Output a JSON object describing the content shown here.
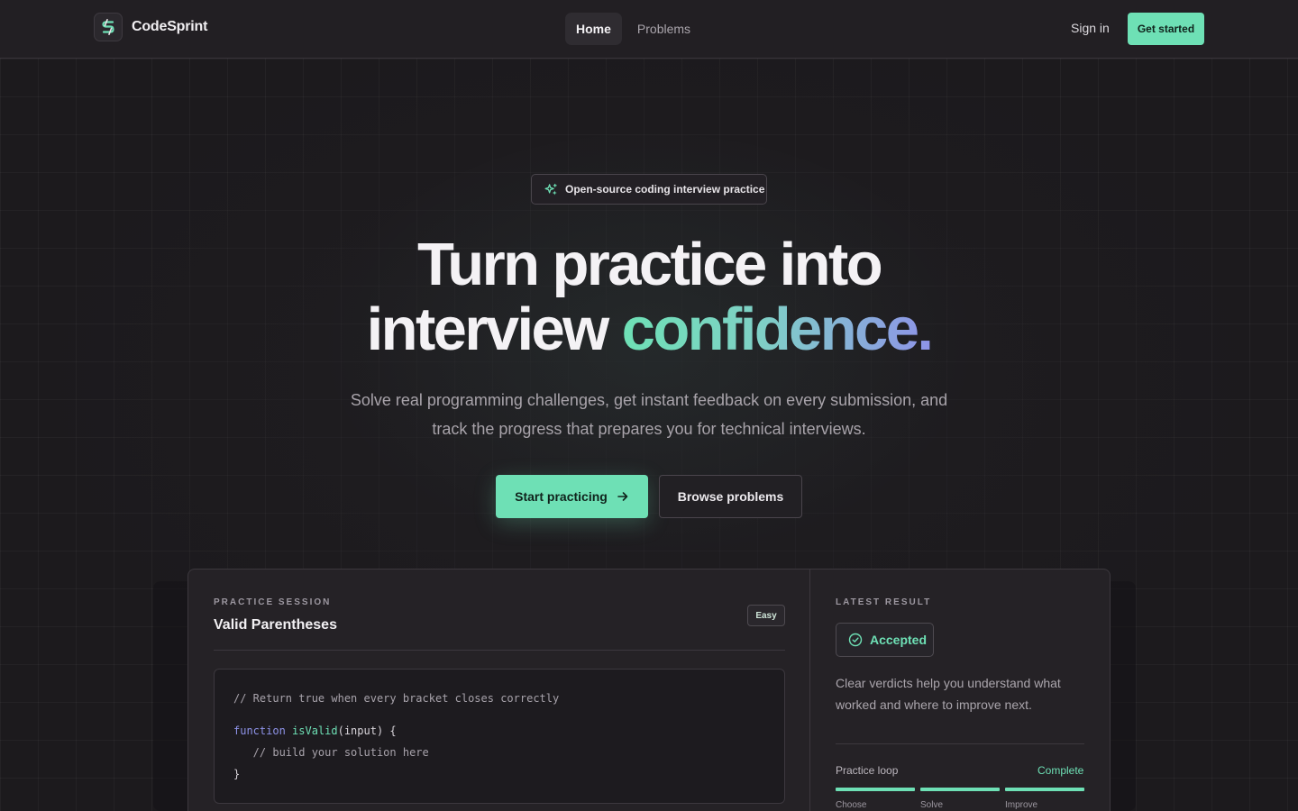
{
  "nav": {
    "brand": "CodeSprint",
    "links": [
      {
        "label": "Home",
        "active": true
      },
      {
        "label": "Problems",
        "active": false
      }
    ],
    "sign_in": "Sign in",
    "get_started": "Get started"
  },
  "hero": {
    "badge": "Open-source coding interview practice",
    "headline_line1": "Turn practice into",
    "headline_line2_plain": "interview ",
    "headline_line2_accent": "confidence.",
    "subtext": "Solve real programming challenges, get instant feedback on every submission, and track the progress that prepares you for technical interviews.",
    "primary_cta": "Start practicing",
    "secondary_cta": "Browse problems"
  },
  "session": {
    "eyebrow": "PRACTICE SESSION",
    "title": "Valid Parentheses",
    "difficulty": "Easy",
    "code": {
      "comment": "// Return true when every bracket closes correctly",
      "keyword": "function",
      "fn_name": "isValid",
      "signature_rest": "(input) {",
      "body_comment": "   // build your solution here",
      "closing": "}"
    }
  },
  "result": {
    "eyebrow": "LATEST RESULT",
    "verdict": "Accepted",
    "description": "Clear verdicts help you understand what worked and where to improve next.",
    "loop_label": "Practice loop",
    "loop_status": "Complete",
    "steps": [
      "Choose",
      "Solve",
      "Improve"
    ]
  },
  "colors": {
    "accent": "#6ee0b5",
    "accent_secondary": "#8e93e8",
    "background": "#1c1a1d"
  }
}
